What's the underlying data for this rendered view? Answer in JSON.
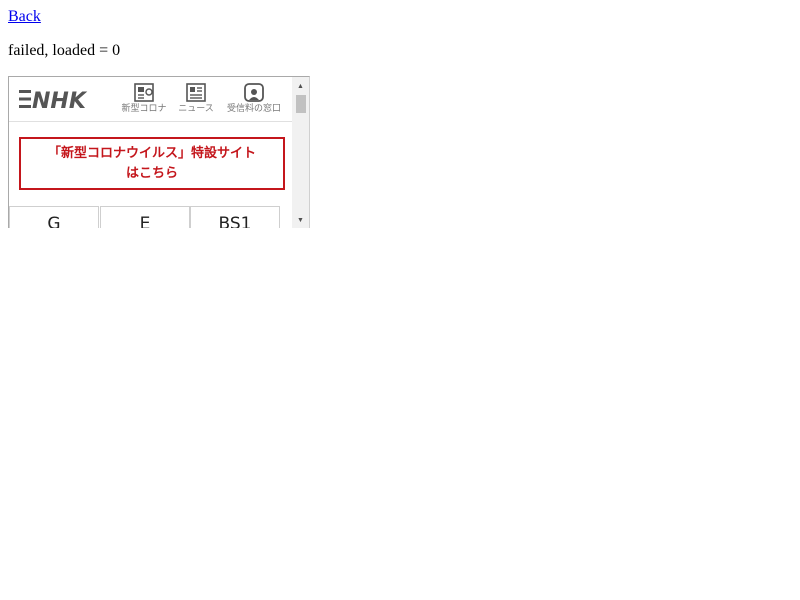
{
  "page": {
    "back_link": "Back",
    "status": "failed, loaded = 0"
  },
  "embedded": {
    "logo_text": "NHK",
    "nav": [
      {
        "label": "新型コロナ",
        "icon": "corona-news-icon"
      },
      {
        "label": "ニュース",
        "icon": "newspaper-icon"
      },
      {
        "label": "受信料の窓口",
        "icon": "tv-window-icon"
      }
    ],
    "banner_line1": "「新型コロナウイルス」特設サイト",
    "banner_line2": "はこちら",
    "channels": [
      "G",
      "E",
      "BS1"
    ],
    "colors": {
      "brand": "#555555",
      "banner_red": "#c4161c",
      "link": "#0000ee"
    }
  }
}
